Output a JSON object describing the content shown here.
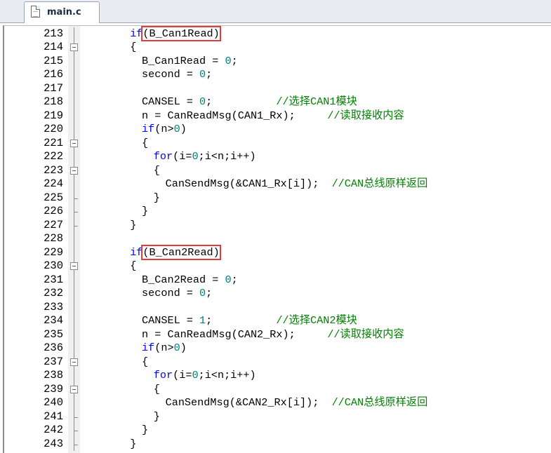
{
  "tab": {
    "label": "main.c",
    "icon": "c-file-icon"
  },
  "colors": {
    "keyword": "#0000ff",
    "number": "#008080",
    "comment": "#008000",
    "plain": "#000000",
    "highlight_box": "#e03c3c"
  },
  "editor": {
    "lines": [
      {
        "num": "213",
        "fold": "line",
        "indent": 8,
        "tokens": [
          [
            "kw",
            "if"
          ],
          [
            "hl",
            "(B_Can1Read)"
          ]
        ]
      },
      {
        "num": "214",
        "fold": "open",
        "indent": 8,
        "tokens": [
          [
            "p",
            "{"
          ]
        ]
      },
      {
        "num": "215",
        "fold": "line",
        "indent": 10,
        "tokens": [
          [
            "p",
            "B_Can1Read = "
          ],
          [
            "num",
            "0"
          ],
          [
            "p",
            ";"
          ]
        ]
      },
      {
        "num": "216",
        "fold": "line",
        "indent": 10,
        "tokens": [
          [
            "p",
            "second = "
          ],
          [
            "num",
            "0"
          ],
          [
            "p",
            ";"
          ]
        ]
      },
      {
        "num": "217",
        "fold": "line",
        "indent": 0,
        "tokens": []
      },
      {
        "num": "218",
        "fold": "line",
        "indent": 10,
        "tokens": [
          [
            "p",
            "CANSEL = "
          ],
          [
            "num",
            "0"
          ],
          [
            "p",
            ";          "
          ],
          [
            "cm",
            "//选择CAN1模块"
          ]
        ]
      },
      {
        "num": "219",
        "fold": "line",
        "indent": 10,
        "tokens": [
          [
            "p",
            "n = CanReadMsg(CAN1_Rx);     "
          ],
          [
            "cm",
            "//读取接收内容"
          ]
        ]
      },
      {
        "num": "220",
        "fold": "line",
        "indent": 10,
        "tokens": [
          [
            "kw",
            "if"
          ],
          [
            "p",
            "(n>"
          ],
          [
            "num",
            "0"
          ],
          [
            "p",
            ")"
          ]
        ]
      },
      {
        "num": "221",
        "fold": "open",
        "indent": 10,
        "tokens": [
          [
            "p",
            "{"
          ]
        ]
      },
      {
        "num": "222",
        "fold": "line",
        "indent": 12,
        "tokens": [
          [
            "kw",
            "for"
          ],
          [
            "p",
            "(i="
          ],
          [
            "num",
            "0"
          ],
          [
            "p",
            ";i<n;i++)"
          ]
        ]
      },
      {
        "num": "223",
        "fold": "open",
        "indent": 12,
        "tokens": [
          [
            "p",
            "{"
          ]
        ]
      },
      {
        "num": "224",
        "fold": "line",
        "indent": 14,
        "tokens": [
          [
            "p",
            "CanSendMsg(&CAN1_Rx[i]);  "
          ],
          [
            "cm",
            "//CAN总线原样返回"
          ]
        ]
      },
      {
        "num": "225",
        "fold": "end",
        "indent": 12,
        "tokens": [
          [
            "p",
            "}"
          ]
        ]
      },
      {
        "num": "226",
        "fold": "end",
        "indent": 10,
        "tokens": [
          [
            "p",
            "}"
          ]
        ]
      },
      {
        "num": "227",
        "fold": "end",
        "indent": 8,
        "tokens": [
          [
            "p",
            "}"
          ]
        ]
      },
      {
        "num": "228",
        "fold": "line",
        "indent": 0,
        "tokens": []
      },
      {
        "num": "229",
        "fold": "line",
        "indent": 8,
        "tokens": [
          [
            "kw",
            "if"
          ],
          [
            "hl",
            "(B_Can2Read)"
          ]
        ]
      },
      {
        "num": "230",
        "fold": "open",
        "indent": 8,
        "tokens": [
          [
            "p",
            "{"
          ]
        ]
      },
      {
        "num": "231",
        "fold": "line",
        "indent": 10,
        "tokens": [
          [
            "p",
            "B_Can2Read = "
          ],
          [
            "num",
            "0"
          ],
          [
            "p",
            ";"
          ]
        ]
      },
      {
        "num": "232",
        "fold": "line",
        "indent": 10,
        "tokens": [
          [
            "p",
            "second = "
          ],
          [
            "num",
            "0"
          ],
          [
            "p",
            ";"
          ]
        ]
      },
      {
        "num": "233",
        "fold": "line",
        "indent": 0,
        "tokens": []
      },
      {
        "num": "234",
        "fold": "line",
        "indent": 10,
        "tokens": [
          [
            "p",
            "CANSEL = "
          ],
          [
            "num",
            "1"
          ],
          [
            "p",
            ";          "
          ],
          [
            "cm",
            "//选择CAN2模块"
          ]
        ]
      },
      {
        "num": "235",
        "fold": "line",
        "indent": 10,
        "tokens": [
          [
            "p",
            "n = CanReadMsg(CAN2_Rx);     "
          ],
          [
            "cm",
            "//读取接收内容"
          ]
        ]
      },
      {
        "num": "236",
        "fold": "line",
        "indent": 10,
        "tokens": [
          [
            "kw",
            "if"
          ],
          [
            "p",
            "(n>"
          ],
          [
            "num",
            "0"
          ],
          [
            "p",
            ")"
          ]
        ]
      },
      {
        "num": "237",
        "fold": "open",
        "indent": 10,
        "tokens": [
          [
            "p",
            "{"
          ]
        ]
      },
      {
        "num": "238",
        "fold": "line",
        "indent": 12,
        "tokens": [
          [
            "kw",
            "for"
          ],
          [
            "p",
            "(i="
          ],
          [
            "num",
            "0"
          ],
          [
            "p",
            ";i<n;i++)"
          ]
        ]
      },
      {
        "num": "239",
        "fold": "open",
        "indent": 12,
        "tokens": [
          [
            "p",
            "{"
          ]
        ]
      },
      {
        "num": "240",
        "fold": "line",
        "indent": 14,
        "tokens": [
          [
            "p",
            "CanSendMsg(&CAN2_Rx[i]);  "
          ],
          [
            "cm",
            "//CAN总线原样返回"
          ]
        ]
      },
      {
        "num": "241",
        "fold": "end",
        "indent": 12,
        "tokens": [
          [
            "p",
            "}"
          ]
        ]
      },
      {
        "num": "242",
        "fold": "end",
        "indent": 10,
        "tokens": [
          [
            "p",
            "}"
          ]
        ]
      },
      {
        "num": "243",
        "fold": "end",
        "indent": 8,
        "tokens": [
          [
            "p",
            "}"
          ]
        ]
      }
    ]
  }
}
